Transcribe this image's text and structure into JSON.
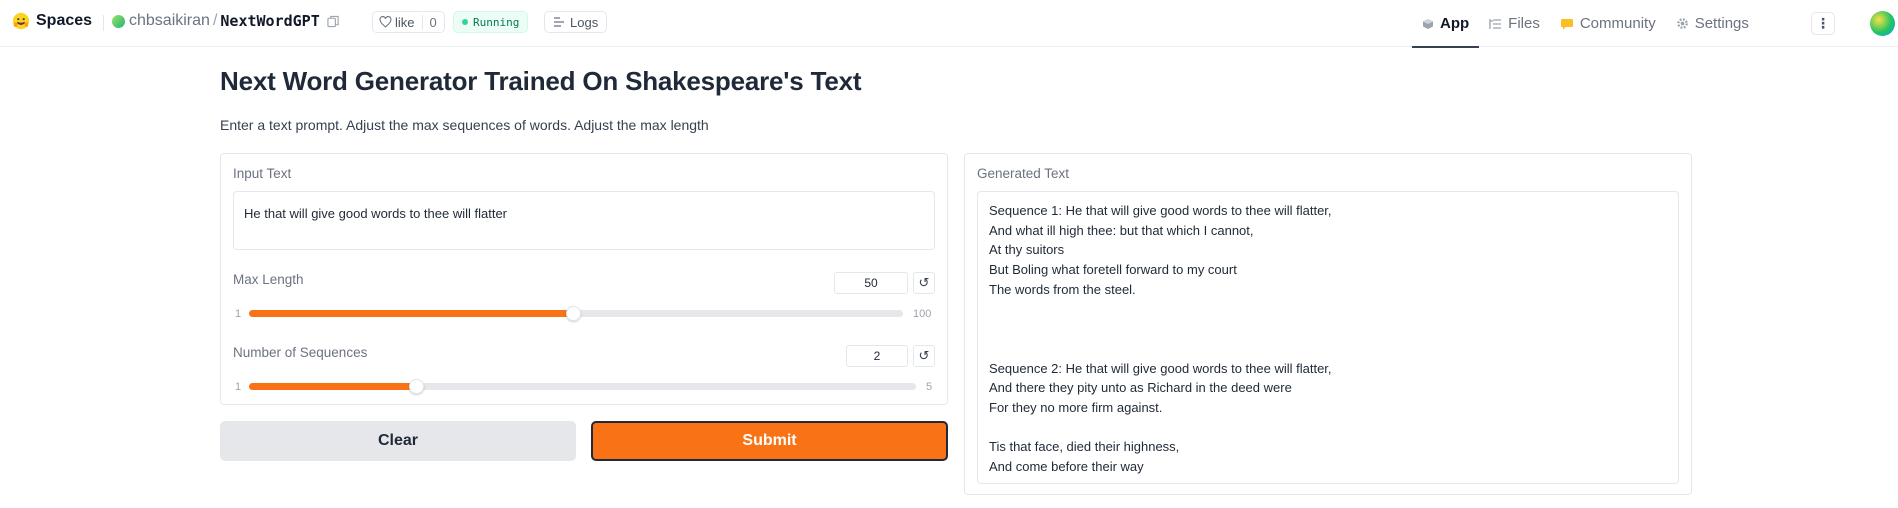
{
  "nav": {
    "brand": "Spaces",
    "owner": "chbsaikiran",
    "path_separator": "/",
    "space_name": "NextWordGPT",
    "like_label": "like",
    "like_count": "0",
    "status": "Running",
    "logs_label": "Logs",
    "tabs": [
      {
        "label": "App",
        "icon": "cube-icon",
        "active": true
      },
      {
        "label": "Files",
        "icon": "files-icon",
        "active": false
      },
      {
        "label": "Community",
        "icon": "community-icon",
        "active": false
      },
      {
        "label": "Settings",
        "icon": "gear-icon",
        "active": false
      }
    ]
  },
  "main": {
    "title": "Next Word Generator Trained On Shakespeare's Text",
    "description": "Enter a text prompt. Adjust the max sequences of words. Adjust the max length",
    "input": {
      "label": "Input Text",
      "value": "He that will give good words to thee will flatter"
    },
    "max_length": {
      "label": "Max Length",
      "value": "50",
      "min": "1",
      "max": "100",
      "fraction": 0.495
    },
    "num_sequences": {
      "label": "Number of Sequences",
      "value": "2",
      "min": "1",
      "max": "5",
      "fraction": 0.25
    },
    "clear_label": "Clear",
    "submit_label": "Submit",
    "output": {
      "label": "Generated Text",
      "lines": [
        "Sequence 1: He that will give good words to thee will flatter,",
        "And what ill high thee: but that which I cannot,",
        "At thy suitors",
        "But Boling what foretell forward to my court",
        "The words from the steel.",
        "",
        "",
        "",
        "Sequence 2: He that will give good words to thee will flatter,",
        "And there they pity unto as Richard in the deed were",
        "For they no more firm against.",
        "",
        "Tis that face, died their highness,",
        "And come before their way"
      ]
    }
  },
  "colors": {
    "accent": "#f97316",
    "running_bg": "#ecfdf5",
    "running_text": "#047857"
  }
}
